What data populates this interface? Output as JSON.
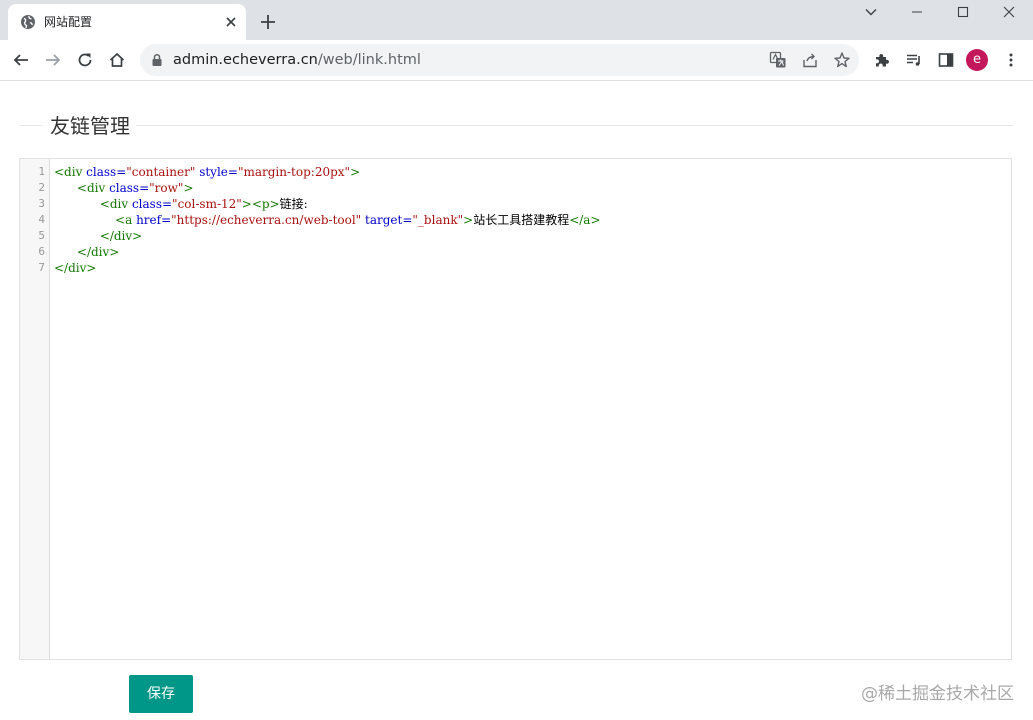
{
  "browser": {
    "tab": {
      "title": "网站配置"
    },
    "address": {
      "domain": "admin.echeverra.cn",
      "path": "/web/link.html"
    },
    "profile_initial": "e"
  },
  "page": {
    "legend": "友链管理",
    "save_label": "保存",
    "watermark": "@稀土掘金技术社区"
  },
  "editor": {
    "line_numbers": [
      "1",
      "2",
      "3",
      "4",
      "5",
      "6",
      "7"
    ],
    "lines": [
      [
        {
          "t": "tag",
          "v": "<div "
        },
        {
          "t": "attr",
          "v": "class="
        },
        {
          "t": "str",
          "v": "\"container\""
        },
        {
          "t": "txt",
          "v": " "
        },
        {
          "t": "attr",
          "v": "style="
        },
        {
          "t": "str",
          "v": "\"margin-top:20px\""
        },
        {
          "t": "tag",
          "v": ">"
        }
      ],
      [
        {
          "t": "txt",
          "v": "      "
        },
        {
          "t": "tag",
          "v": "<div "
        },
        {
          "t": "attr",
          "v": "class="
        },
        {
          "t": "str",
          "v": "\"row\""
        },
        {
          "t": "tag",
          "v": ">"
        }
      ],
      [
        {
          "t": "txt",
          "v": "            "
        },
        {
          "t": "tag",
          "v": "<div "
        },
        {
          "t": "attr",
          "v": "class="
        },
        {
          "t": "str",
          "v": "\"col-sm-12\""
        },
        {
          "t": "tag",
          "v": "><p>"
        },
        {
          "t": "txt",
          "v": "链接:"
        }
      ],
      [
        {
          "t": "txt",
          "v": "                "
        },
        {
          "t": "tag",
          "v": "<a "
        },
        {
          "t": "attr",
          "v": "href="
        },
        {
          "t": "str",
          "v": "\"https://echeverra.cn/web-tool\""
        },
        {
          "t": "txt",
          "v": " "
        },
        {
          "t": "attr",
          "v": "target="
        },
        {
          "t": "str",
          "v": "\"_blank\""
        },
        {
          "t": "tag",
          "v": ">"
        },
        {
          "t": "txt",
          "v": "站长工具搭建教程"
        },
        {
          "t": "tag",
          "v": "</a>"
        }
      ],
      [
        {
          "t": "txt",
          "v": "            "
        },
        {
          "t": "tag",
          "v": "</div>"
        }
      ],
      [
        {
          "t": "txt",
          "v": "      "
        },
        {
          "t": "tag",
          "v": "</div>"
        }
      ],
      [
        {
          "t": "tag",
          "v": "</div>"
        }
      ]
    ]
  },
  "colors": {
    "accent": "#009688",
    "tag": "#117700",
    "attr": "#0000cc",
    "string": "#aa1111"
  }
}
